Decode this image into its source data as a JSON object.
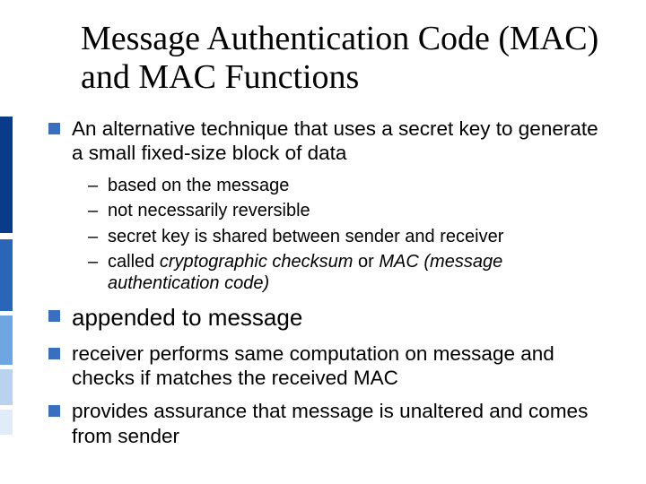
{
  "title": "Message Authentication Code (MAC) and MAC Functions",
  "bullets": {
    "b1": {
      "text": "An alternative technique that uses a secret key to generate a small fixed-size block of data",
      "sub": {
        "s1": "based on the message",
        "s2": "not necessarily reversible",
        "s3": "secret key is shared between sender and receiver",
        "s4_pre": "called ",
        "s4_i1": "cryptographic checksum",
        "s4_mid": " or ",
        "s4_i2": "MAC (message authentication code)"
      }
    },
    "b2": {
      "text": "appended to message"
    },
    "b3": {
      "text": "receiver performs same computation on message and checks if matches the received MAC"
    },
    "b4": {
      "text": "provides assurance that message is unaltered and comes from sender"
    }
  }
}
